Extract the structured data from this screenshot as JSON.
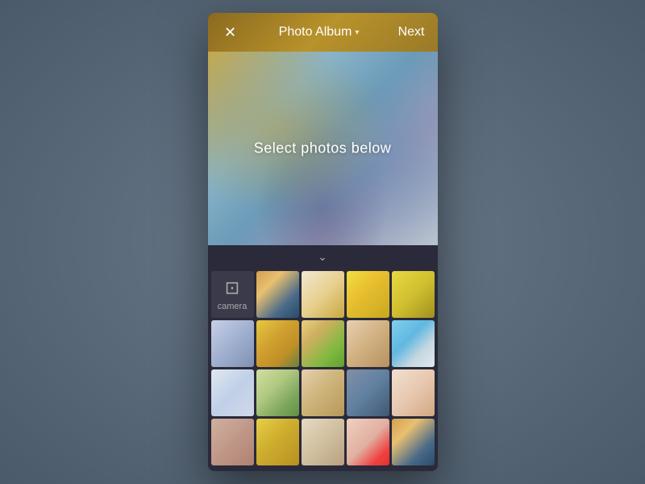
{
  "header": {
    "close_label": "✕",
    "title": "Photo Album",
    "dropdown_icon": "▾",
    "next_label": "Next"
  },
  "preview": {
    "placeholder_text": "Select photos below"
  },
  "divider": {
    "icon": "⌄"
  },
  "grid": {
    "camera_label": "camera",
    "camera_icon": "⊡"
  }
}
